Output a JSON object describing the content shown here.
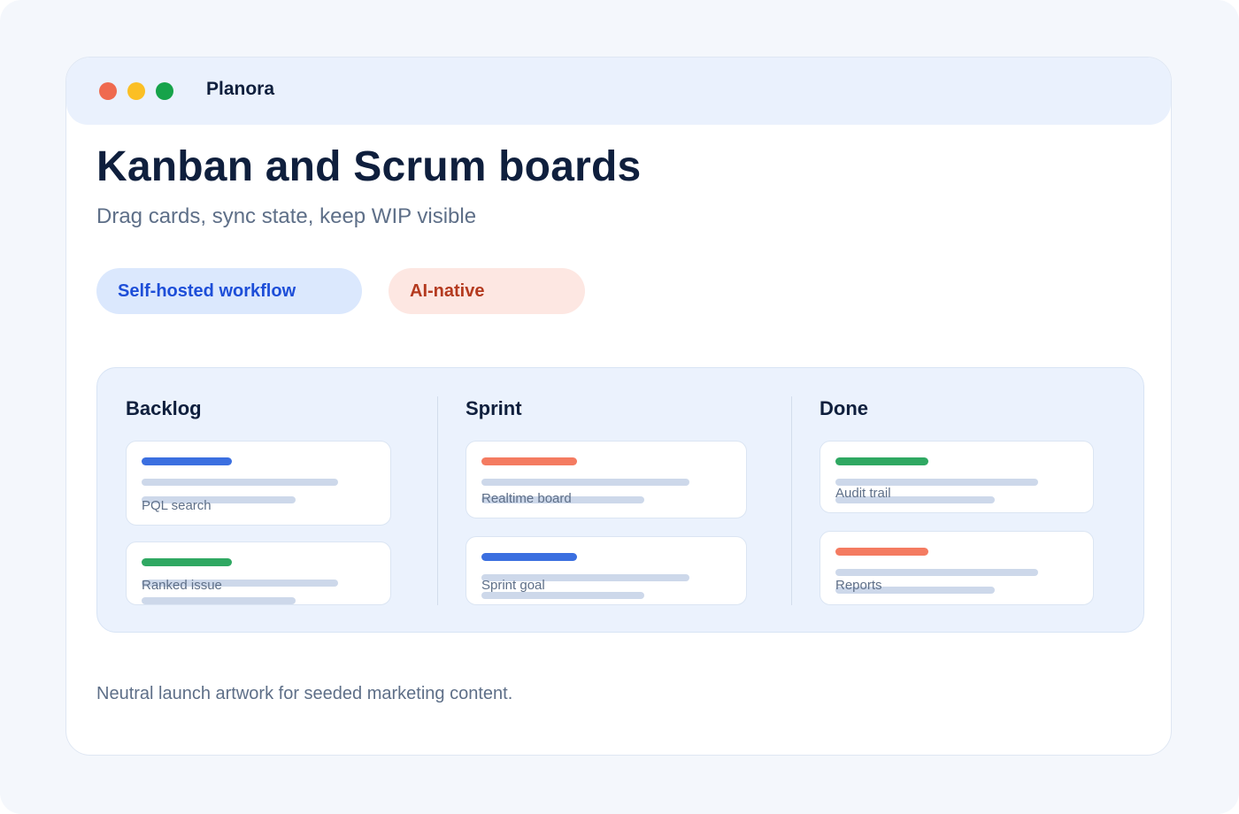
{
  "window": {
    "app_name": "Planora",
    "controls": [
      {
        "name": "close",
        "color": "#ef6a4f"
      },
      {
        "name": "minimize",
        "color": "#fbbf24"
      },
      {
        "name": "maximize",
        "color": "#16a34a"
      }
    ]
  },
  "hero": {
    "title": "Kanban and Scrum boards",
    "subtitle": "Drag cards, sync state, keep WIP visible"
  },
  "pills": [
    {
      "label": "Self-hosted workflow",
      "text_color": "#1d4ed8",
      "bg_color": "#dbe8fd"
    },
    {
      "label": "AI-native",
      "text_color": "#b43a1f",
      "bg_color": "#fde7e2"
    }
  ],
  "colors": {
    "blue": "#3b6fe0",
    "green": "#2fa862",
    "orange": "#f47b61",
    "placeholder_line": "#cdd8ea"
  },
  "board": {
    "columns": [
      {
        "title": "Backlog",
        "cards": [
          {
            "label": "PQL search",
            "tag_color": "blue"
          },
          {
            "label": "Ranked issue",
            "tag_color": "green"
          }
        ]
      },
      {
        "title": "Sprint",
        "cards": [
          {
            "label": "Realtime board",
            "tag_color": "orange"
          },
          {
            "label": "Sprint goal",
            "tag_color": "blue"
          }
        ]
      },
      {
        "title": "Done",
        "cards": [
          {
            "label": "Audit trail",
            "tag_color": "green"
          },
          {
            "label": "Reports",
            "tag_color": "orange"
          }
        ]
      }
    ]
  },
  "footer": {
    "caption": "Neutral launch artwork for seeded marketing content."
  }
}
